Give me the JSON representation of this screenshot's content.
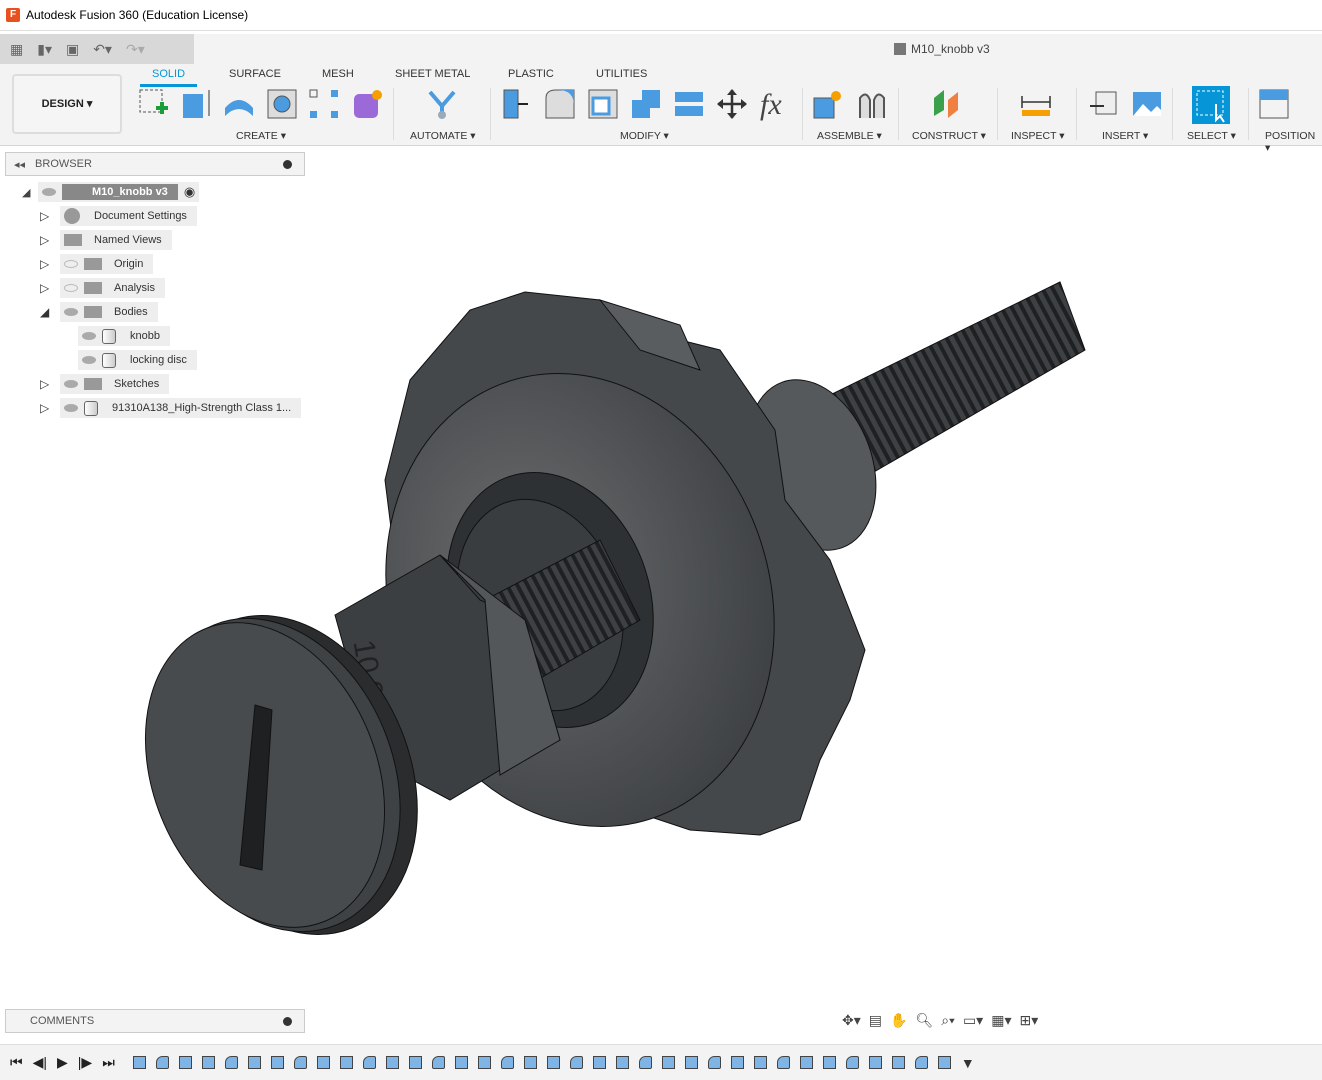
{
  "window": {
    "title": "Autodesk Fusion 360 (Education License)",
    "app_icon": "F"
  },
  "document": {
    "title": "M10_knobb v3"
  },
  "workspace": {
    "label": "DESIGN ▾"
  },
  "tabs": [
    {
      "label": "SOLID",
      "active": true
    },
    {
      "label": "SURFACE"
    },
    {
      "label": "MESH"
    },
    {
      "label": "SHEET METAL"
    },
    {
      "label": "PLASTIC"
    },
    {
      "label": "UTILITIES"
    }
  ],
  "groups": [
    {
      "label": "CREATE ▾"
    },
    {
      "label": "AUTOMATE ▾"
    },
    {
      "label": "MODIFY ▾"
    },
    {
      "label": "ASSEMBLE ▾"
    },
    {
      "label": "CONSTRUCT ▾"
    },
    {
      "label": "INSPECT ▾"
    },
    {
      "label": "INSERT ▾"
    },
    {
      "label": "SELECT ▾"
    },
    {
      "label": "POSITION ▾"
    }
  ],
  "browser": {
    "title": "BROWSER",
    "root": "M10_knobb v3",
    "items": [
      {
        "label": "Document Settings"
      },
      {
        "label": "Named Views"
      },
      {
        "label": "Origin"
      },
      {
        "label": "Analysis"
      },
      {
        "label": "Bodies"
      },
      {
        "label": "knobb"
      },
      {
        "label": "locking disc"
      },
      {
        "label": "Sketches"
      },
      {
        "label": "91310A138_High-Strength Class 1..."
      }
    ]
  },
  "comments": {
    "title": "COMMENTS"
  },
  "model": {
    "nut_marking": "10.9"
  },
  "colors": {
    "accent": "#0696d7",
    "model": "#4a4d50"
  }
}
